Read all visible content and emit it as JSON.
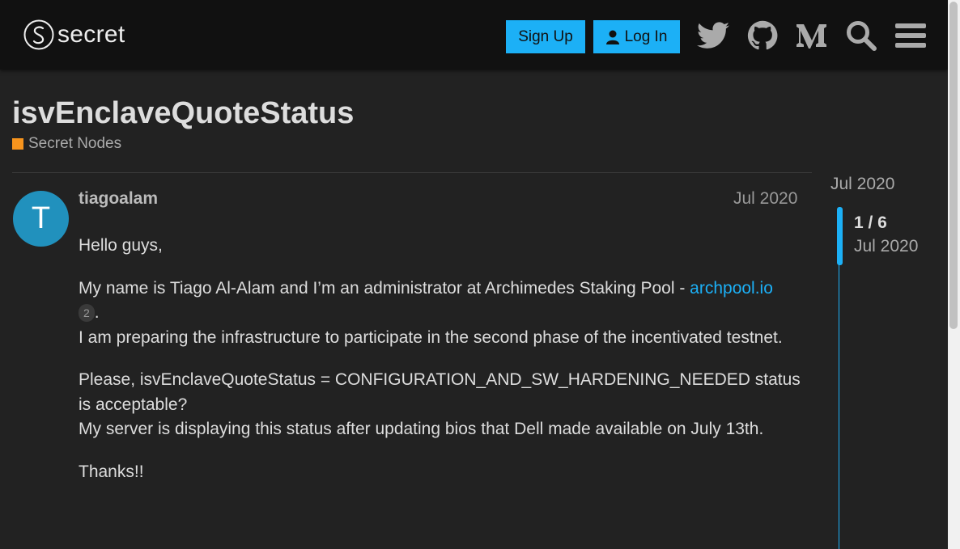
{
  "header": {
    "logo_text": "secret",
    "signup_label": "Sign Up",
    "login_label": "Log In",
    "icons": [
      "twitter-icon",
      "github-icon",
      "medium-icon",
      "search-icon",
      "menu-icon"
    ]
  },
  "topic": {
    "title": "isvEnclaveQuoteStatus",
    "category": "Secret Nodes",
    "category_color": "#f7941d"
  },
  "post": {
    "avatar_letter": "T",
    "avatar_color": "#2191bd",
    "username": "tiagoalam",
    "date": "Jul 2020",
    "p1": "Hello guys,",
    "p2_text": "My name is Tiago Al-Alam and I’m an administrator at Archimedes Staking Pool - ",
    "p2_link": "archpool.io",
    "p2_clicks": "2",
    "p2_end": ".",
    "p2_line2": "I am preparing the infrastructure to participate in the second phase of the incentivated testnet.",
    "p3_line1": "Please, isvEnclaveQuoteStatus = CONFIGURATION_AND_SW_HARDENING_NEEDED status is acceptable?",
    "p3_line2": "My server is displaying this status after updating bios that Dell made available on July 13th.",
    "p4": "Thanks!!"
  },
  "timeline": {
    "top_date": "Jul 2020",
    "position": "1 / 6",
    "current_date": "Jul 2020"
  },
  "colors": {
    "accent": "#1cb0f6",
    "background": "#222222",
    "header_bg": "#111111"
  }
}
